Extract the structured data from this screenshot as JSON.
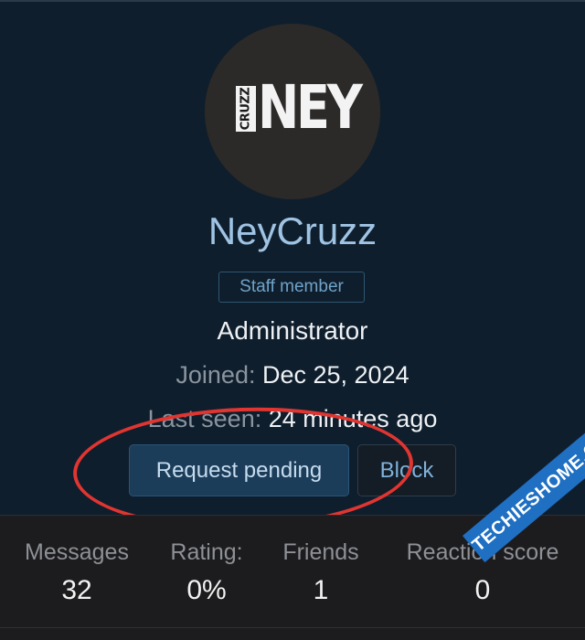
{
  "profile": {
    "avatar_logo_small": "CRUZZ",
    "avatar_logo_main": "NEY",
    "username": "NeyCruzz",
    "badge": "Staff member",
    "role": "Administrator",
    "joined_label": "Joined:",
    "joined_value": "Dec 25, 2024",
    "last_seen_label": "Last seen:",
    "last_seen_value": "24 minutes ago"
  },
  "actions": {
    "request_label": "Request pending",
    "block_label": "Block"
  },
  "stats": [
    {
      "label": "Messages",
      "value": "32"
    },
    {
      "label": "Rating:",
      "value": "0%"
    },
    {
      "label": "Friends",
      "value": "1"
    },
    {
      "label": "Reaction score",
      "value": "0"
    }
  ],
  "watermark": "TECHIESHOME.COM",
  "colors": {
    "username": "#9fc3e3",
    "highlight": "#e03530",
    "request_button": "#1b3d5a"
  }
}
